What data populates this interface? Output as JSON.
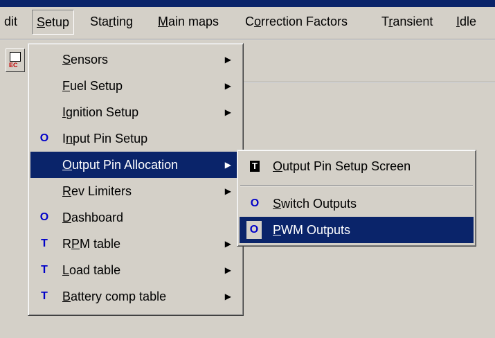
{
  "menubar": {
    "items": [
      {
        "label": "dit",
        "ul": ""
      },
      {
        "pre": "",
        "ul": "S",
        "post": "etup"
      },
      {
        "pre": "Sta",
        "ul": "r",
        "post": "ting"
      },
      {
        "pre": "",
        "ul": "M",
        "post": "ain maps"
      },
      {
        "pre": "C",
        "ul": "o",
        "post": "rrection Factors"
      },
      {
        "pre": "T",
        "ul": "r",
        "post": "ansient"
      },
      {
        "pre": "",
        "ul": "I",
        "post": "dle"
      }
    ]
  },
  "toolbar": {
    "button_badge": "EC"
  },
  "setup_menu": {
    "items": [
      {
        "icon": "",
        "ul": "S",
        "post": "ensors",
        "arrow": "▶"
      },
      {
        "icon": "",
        "ul": "F",
        "post": "uel Setup",
        "arrow": "▶"
      },
      {
        "icon": "",
        "ul": "I",
        "post": "gnition Setup",
        "arrow": "▶"
      },
      {
        "icon": "O",
        "pre": "I",
        "ul": "n",
        "post": "put Pin Setup",
        "arrow": ""
      },
      {
        "icon": "",
        "ul": "O",
        "post": "utput Pin Allocation",
        "arrow": "▶"
      },
      {
        "icon": "",
        "ul": "R",
        "post": "ev Limiters",
        "arrow": "▶"
      },
      {
        "icon": "O",
        "ul": "D",
        "post": "ashboard",
        "arrow": ""
      },
      {
        "icon": "T",
        "pre": "R",
        "ul": "P",
        "post": "M table",
        "arrow": "▶"
      },
      {
        "icon": "T",
        "ul": "L",
        "post": "oad table",
        "arrow": "▶"
      },
      {
        "icon": "T",
        "ul": "B",
        "post": "attery comp table",
        "arrow": "▶"
      }
    ]
  },
  "output_submenu": {
    "items": [
      {
        "icon": "T",
        "ul": "O",
        "post": "utput Pin Setup Screen"
      },
      {
        "icon": "O",
        "ul": "S",
        "post": "witch Outputs"
      },
      {
        "icon": "O",
        "ul": "P",
        "post": "WM Outputs"
      }
    ]
  }
}
